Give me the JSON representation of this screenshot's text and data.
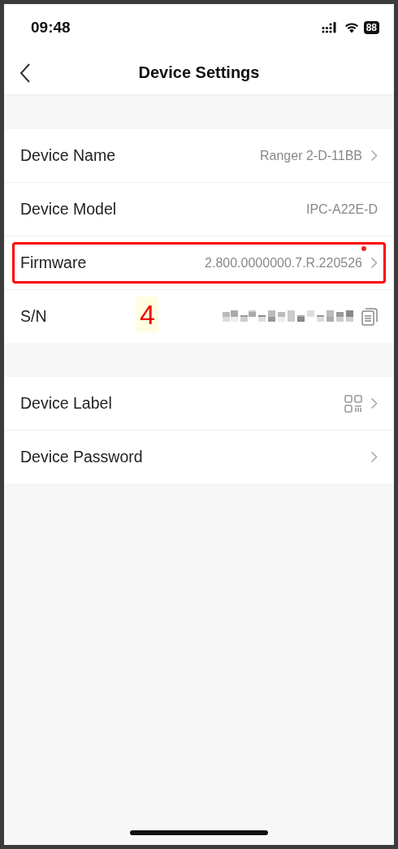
{
  "status_bar": {
    "time": "09:48",
    "battery": "88"
  },
  "nav_bar": {
    "title": "Device Settings"
  },
  "groups": [
    {
      "rows": [
        {
          "label": "Device Name",
          "kind": "text",
          "value": "Ranger 2-D-11BB",
          "chevron": true,
          "copy_icon": false,
          "update_dot": false,
          "highlighted": false
        },
        {
          "label": "Device Model",
          "kind": "text",
          "value": "IPC-A22E-D",
          "chevron": false,
          "copy_icon": false,
          "update_dot": false,
          "highlighted": false
        },
        {
          "label": "Firmware",
          "kind": "text",
          "value": "2.800.0000000.7.R.220526",
          "chevron": true,
          "copy_icon": false,
          "update_dot": true,
          "highlighted": true
        },
        {
          "label": "S/N",
          "kind": "redacted",
          "chevron": false,
          "copy_icon": true,
          "update_dot": false,
          "highlighted": false,
          "annotation": "4"
        }
      ]
    },
    {
      "rows": [
        {
          "label": "Device Label",
          "kind": "qr",
          "chevron": true,
          "copy_icon": false,
          "update_dot": false,
          "highlighted": false
        },
        {
          "label": "Device Password",
          "kind": "plain",
          "chevron": true,
          "copy_icon": false,
          "update_dot": false,
          "highlighted": false
        }
      ]
    }
  ]
}
